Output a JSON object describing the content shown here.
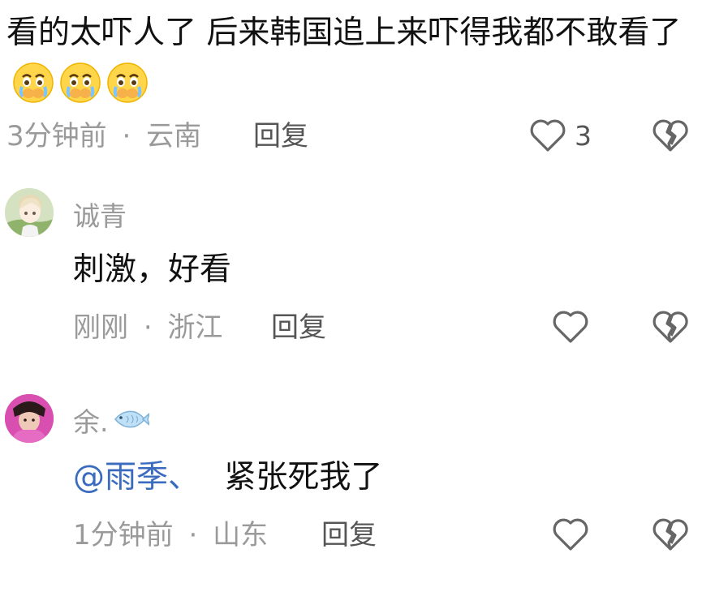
{
  "comments": [
    {
      "text": "看的太吓人了 后来韩国追上来吓得我都不敢看了",
      "emojis": [
        "crying-face-icon",
        "crying-face-icon",
        "crying-face-icon"
      ],
      "time": "3分钟前",
      "location": "云南",
      "separator": "·",
      "reply_label": "回复",
      "likes": "3"
    },
    {
      "username": "诚青",
      "text": "刺激，好看",
      "time": "刚刚",
      "location": "浙江",
      "separator": "·",
      "reply_label": "回复"
    },
    {
      "username": "余.",
      "username_icon": "fish-icon",
      "mention": "@雨季、",
      "text": "紧张死我了",
      "time": "1分钟前",
      "location": "山东",
      "separator": "·",
      "reply_label": "回复"
    }
  ],
  "colors": {
    "meta_gray": "#9a9a9a",
    "mention_blue": "#3a6bbf",
    "icon_gray": "#666666"
  }
}
